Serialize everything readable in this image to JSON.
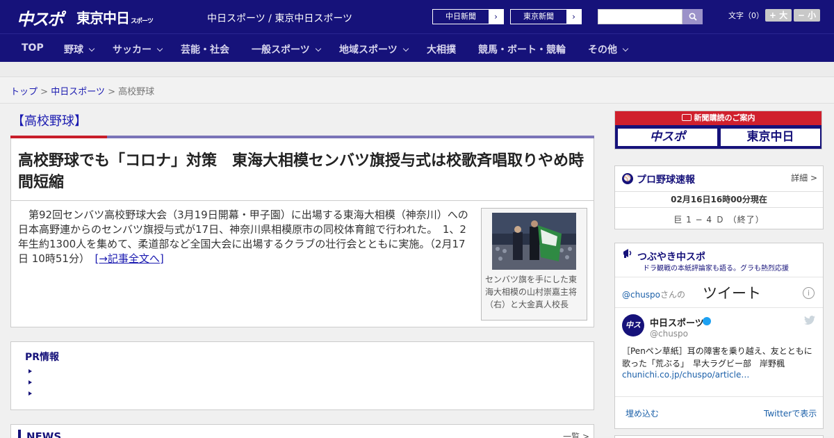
{
  "header": {
    "logo_chuspo": "中スポ",
    "logo_tokyo": "東京中日",
    "logo_tokyo_small": "スポーツ",
    "site_names": "中日スポーツ / 東京中日スポーツ",
    "ext_links": [
      {
        "label": "中日新聞",
        "arrow": "›"
      },
      {
        "label": "東京新聞",
        "arrow": "›"
      }
    ],
    "search": {
      "value": "",
      "placeholder": ""
    },
    "font_size": {
      "label": "文字（0）",
      "increase": "+ 大",
      "decrease": "− 小"
    }
  },
  "nav": {
    "items": [
      {
        "label": "TOP"
      },
      {
        "label": "野球",
        "dropdown": true
      },
      {
        "label": "サッカー",
        "dropdown": true
      },
      {
        "label": "芸能・社会"
      },
      {
        "label": "一般スポーツ",
        "dropdown": true
      },
      {
        "label": "地域スポーツ",
        "dropdown": true
      },
      {
        "label": "大相撲"
      },
      {
        "label": "競馬・ボート・競輪"
      },
      {
        "label": "その他",
        "dropdown": true
      }
    ]
  },
  "breadcrumb": {
    "top": "トップ",
    "sep": ">",
    "chunichi": "中日スポーツ",
    "current": "高校野球"
  },
  "section": {
    "title": "【高校野球】"
  },
  "article": {
    "headline": "高校野球でも「コロナ」対策　東海大相模センバツ旗授与式は校歌斉唱取りやめ時間短縮",
    "lead": "　第92回センバツ高校野球大会（3月19日開幕・甲子園）に出場する東海大相模（神奈川）への日本高野連からのセンバツ旗授与式が17日、神奈川県相模原市の同校体育館で行われた。　1、2年生約1300人を集めて、柔道部など全国大会に出場するクラブの壮行会とともに実施。（2月17日 10時51分）　",
    "more": "[→記事全文へ]",
    "photo_caption": "センバツ旗を手にした東海大相模の山村崇嘉主将（右）と大金真人校長"
  },
  "pr": {
    "title": "PR情報"
  },
  "news": {
    "title": "NEWS",
    "more": "一覧 >"
  },
  "subscription": {
    "head": "新聞購読のご案内",
    "logo_left": "中スポ",
    "logo_right": "東京中日"
  },
  "baseball": {
    "title": "プロ野球速報",
    "detail": "詳細 >",
    "updated": "02月16日16時00分現在",
    "score": "巨 1 − 4 Ｄ （終了）"
  },
  "tweets": {
    "title": "つぶやき中スポ",
    "subtitle": "ドラ観戦の本紙評論家も語る。グラも熱烈応援",
    "handle": "@chuspo",
    "handle_suffix": "さんの",
    "word": "ツイート",
    "info": "i",
    "account_name": "中日スポーツ",
    "account_handle": "@chuspo",
    "avatar": "中スポ",
    "text": "［Penペン草紙］耳の障害を乗り越え、友とともに歌った「荒ぶる」　早大ラグビー部　岸野楓",
    "link": "chunichi.co.jp/chuspo/article…",
    "embed": "埋め込む",
    "view": "Twitterで表示"
  },
  "colors": {
    "brand": "#16127a",
    "accent_red": "#c81e2a",
    "link": "#1a1ab0"
  }
}
